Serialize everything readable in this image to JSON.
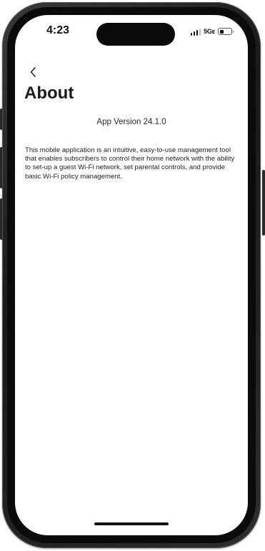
{
  "status_bar": {
    "time": "4:23",
    "network": "5Gᴇ",
    "battery_level": 0.3
  },
  "header": {
    "back_icon": "chevron-left-icon",
    "title": "About"
  },
  "main": {
    "version_label": "App Version 24.1.0",
    "description": "This mobile application is an intuitive, easy-to-use management tool that enables subscribers to control their home network with the ability to set-up a guest Wi-Fi network, set parental controls, and provide basic Wi-Fi policy management."
  }
}
